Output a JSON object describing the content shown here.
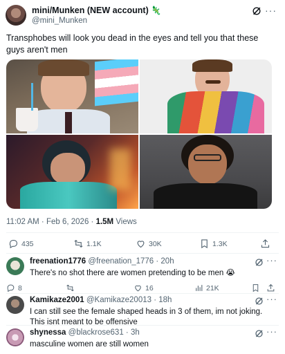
{
  "post": {
    "display_name": "mini/Munken (NEW account)",
    "name_emoji": "🦎",
    "handle": "@mini_Munken",
    "text": "Transphobes will look you dead in the eyes and tell you that these guys aren't men",
    "time_date": "11:02 AM · Feb 6, 2026 · ",
    "views_count": "1.5M",
    "views_label": " Views",
    "actions": {
      "replies": "435",
      "reposts": "1.1K",
      "likes": "30K",
      "bookmarks": "1.3K"
    }
  },
  "replies": [
    {
      "display_name": "freenation1776",
      "handle_time": "@freenation_1776 · 20h",
      "text": "There's no shot there are women pretending to be men 😭",
      "avatar_color": "#3b7a57",
      "actions": {
        "replies": "8",
        "reposts": "",
        "likes": "16",
        "views": "21K"
      }
    },
    {
      "display_name": "Kamikaze2001",
      "handle_time": "@Kamikaze20013 · 18h",
      "text": "I can still see the female shaped heads in 3 of them, im not joking. This isnt meant to be offensive",
      "avatar_color": "#6b6b6b"
    },
    {
      "display_name": "shynessa",
      "handle_time": "@blackrose631 · 3h",
      "text": "masculine women are still women",
      "avatar_color": "#d8b4c8"
    }
  ],
  "icons": {
    "grok": "grok-slash-icon",
    "more": "more-dots-icon",
    "reply": "reply-bubble-icon",
    "repost": "repost-arrows-icon",
    "like": "heart-icon",
    "bookmark": "bookmark-icon",
    "share": "share-upload-icon",
    "views": "views-bars-icon"
  },
  "more_glyph": "···",
  "colors": {
    "text_primary": "#0f1419",
    "text_secondary": "#536471",
    "divider": "#eff3f4"
  }
}
